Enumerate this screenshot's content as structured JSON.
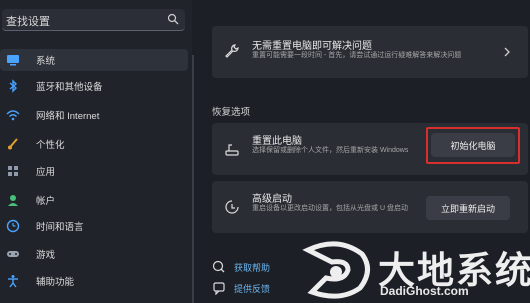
{
  "sidebar": {
    "search_text": "查找设置",
    "items": [
      {
        "label": "系统",
        "icon": "monitor-icon",
        "color": "#4aa3ff"
      },
      {
        "label": "蓝牙和其他设备",
        "icon": "bluetooth-icon",
        "color": "#4aa3ff"
      },
      {
        "label": "网络和 Internet",
        "icon": "wifi-icon",
        "color": "#4aa3ff"
      },
      {
        "label": "个性化",
        "icon": "brush-icon",
        "color": "#e0a030"
      },
      {
        "label": "应用",
        "icon": "apps-icon",
        "color": "#8e9aab"
      },
      {
        "label": "帐户",
        "icon": "account-icon",
        "color": "#46c07a"
      },
      {
        "label": "时间和语言",
        "icon": "globe-clock-icon",
        "color": "#4aa3ff"
      },
      {
        "label": "游戏",
        "icon": "gamepad-icon",
        "color": "#9aa3b0"
      },
      {
        "label": "辅助功能",
        "icon": "accessibility-icon",
        "color": "#4aa3ff"
      }
    ]
  },
  "main": {
    "fix_card": {
      "title": "无需重置电脑即可解决问题",
      "desc": "重置可能需要一段时间 - 首先，请尝试通过运行疑难解答来解决问题"
    },
    "section_title": "恢复选项",
    "reset_card": {
      "title": "重置此电脑",
      "desc": "选择保留或删除个人文件，然后重新安装 Windows",
      "button": "初始化电脑"
    },
    "advanced_card": {
      "title": "高级启动",
      "desc": "重启设备以更改启动设置，包括从光盘或 U 盘启动",
      "button": "立即重新启动"
    },
    "links": [
      {
        "label": "获取帮助",
        "icon": "help-icon"
      },
      {
        "label": "提供反馈",
        "icon": "feedback-icon"
      }
    ]
  },
  "watermark": {
    "cn": "大地系统",
    "en": "DadiGhost.com"
  },
  "colors": {
    "accent": "#4aa3ff",
    "highlight": "#d92e2e",
    "link": "#6cb6f0"
  }
}
